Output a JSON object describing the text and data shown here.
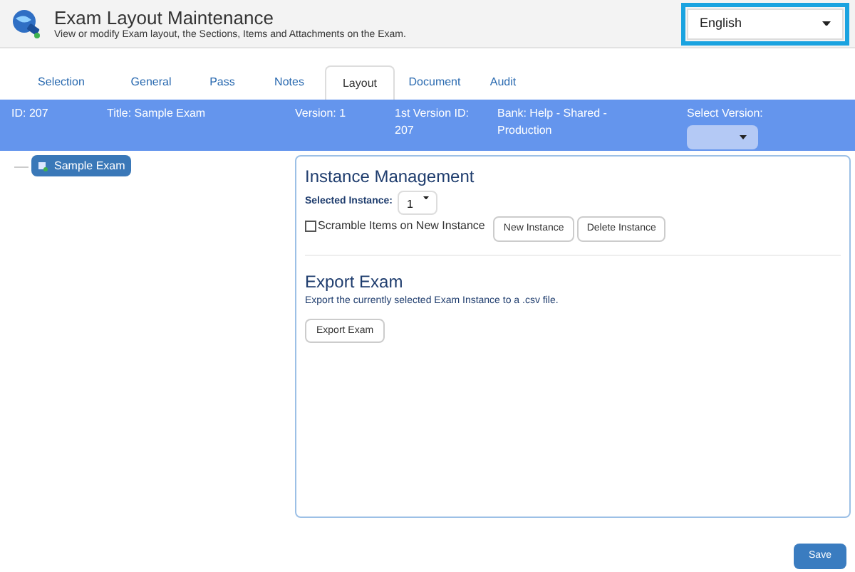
{
  "header": {
    "title": "Exam Layout Maintenance",
    "subtitle": "View or modify Exam layout, the Sections, Items and Attachments on the Exam.",
    "language": "English"
  },
  "tabs": [
    {
      "label": "Selection",
      "selected": false
    },
    {
      "label": "General",
      "selected": false
    },
    {
      "label": "Pass",
      "selected": false
    },
    {
      "label": "Notes",
      "selected": false
    },
    {
      "label": "Layout",
      "selected": true
    },
    {
      "label": "Document",
      "selected": false
    },
    {
      "label": "Audit",
      "selected": false
    }
  ],
  "info_bar": {
    "fields": [
      "ID: 207",
      "Title: Sample Exam",
      "Version: 1",
      "1st Version ID: 207",
      "Bank: Help - Shared - Production"
    ],
    "select_label": "Select Version:"
  },
  "tree": {
    "items": [
      {
        "label": "Sample Exam",
        "selected": true
      }
    ]
  },
  "instance_management": {
    "title": "Instance Management",
    "selected_label": "Selected Instance:",
    "selected_value": "1",
    "scramble": {
      "label": "Scramble Items on New Instance",
      "checked": false
    },
    "buttons": [
      "New Instance",
      "Delete Instance"
    ]
  },
  "export": {
    "title": "Export Exam",
    "description": "Export the currently selected Exam Instance to a .csv file.",
    "button": "Export Exam"
  },
  "save_button": "Save"
}
